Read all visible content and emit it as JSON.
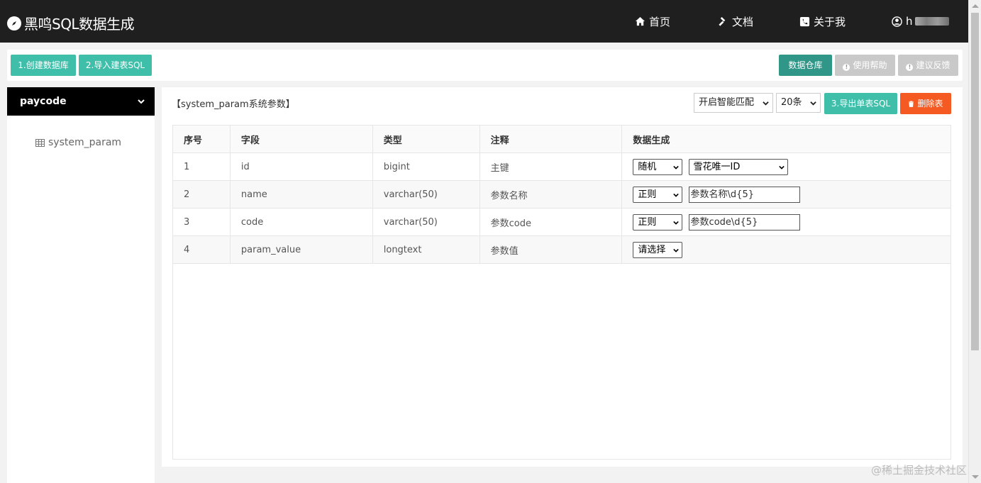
{
  "header": {
    "brand": "黑鸣SQL数据生成",
    "nav": [
      {
        "label": "首页",
        "icon": "home-icon"
      },
      {
        "label": "文档",
        "icon": "gavel-icon"
      },
      {
        "label": "关于我",
        "icon": "phone-icon"
      },
      {
        "label": "h",
        "icon": "user-icon"
      }
    ]
  },
  "toolbar": {
    "create_db": "1.创建数据库",
    "import_sql": "2.导入建表SQL",
    "warehouse": "数据仓库",
    "help": "使用帮助",
    "feedback": "建议反馈"
  },
  "sidebar": {
    "database": "paycode",
    "tables": [
      "system_param"
    ]
  },
  "main": {
    "title": "【system_param系统参数】",
    "smart_match": "开启智能匹配",
    "row_count": "20条",
    "export_sql": "3.导出单表SQL",
    "delete_table": "删除表",
    "columns": [
      "序号",
      "字段",
      "类型",
      "注释",
      "数据生成"
    ],
    "rows": [
      {
        "no": "1",
        "field": "id",
        "type": "bigint",
        "comment": "主键",
        "mode": "随机",
        "rule": "雪花唯一ID",
        "rule_kind": "select"
      },
      {
        "no": "2",
        "field": "name",
        "type": "varchar(50)",
        "comment": "参数名称",
        "mode": "正则",
        "rule": "参数名称\\d{5}",
        "rule_kind": "input"
      },
      {
        "no": "3",
        "field": "code",
        "type": "varchar(50)",
        "comment": "参数code",
        "mode": "正则",
        "rule": "参数code\\d{5}",
        "rule_kind": "input"
      },
      {
        "no": "4",
        "field": "param_value",
        "type": "longtext",
        "comment": "参数值",
        "mode": "请选择",
        "rule": "",
        "rule_kind": "none"
      }
    ]
  },
  "watermark": "@稀土掘金技术社区",
  "colors": {
    "header_bg": "#1f1f1f",
    "teal": "#3fbfaa",
    "dark_teal": "#2f9688",
    "gray": "#c9c9c9",
    "orange": "#f45a22"
  }
}
